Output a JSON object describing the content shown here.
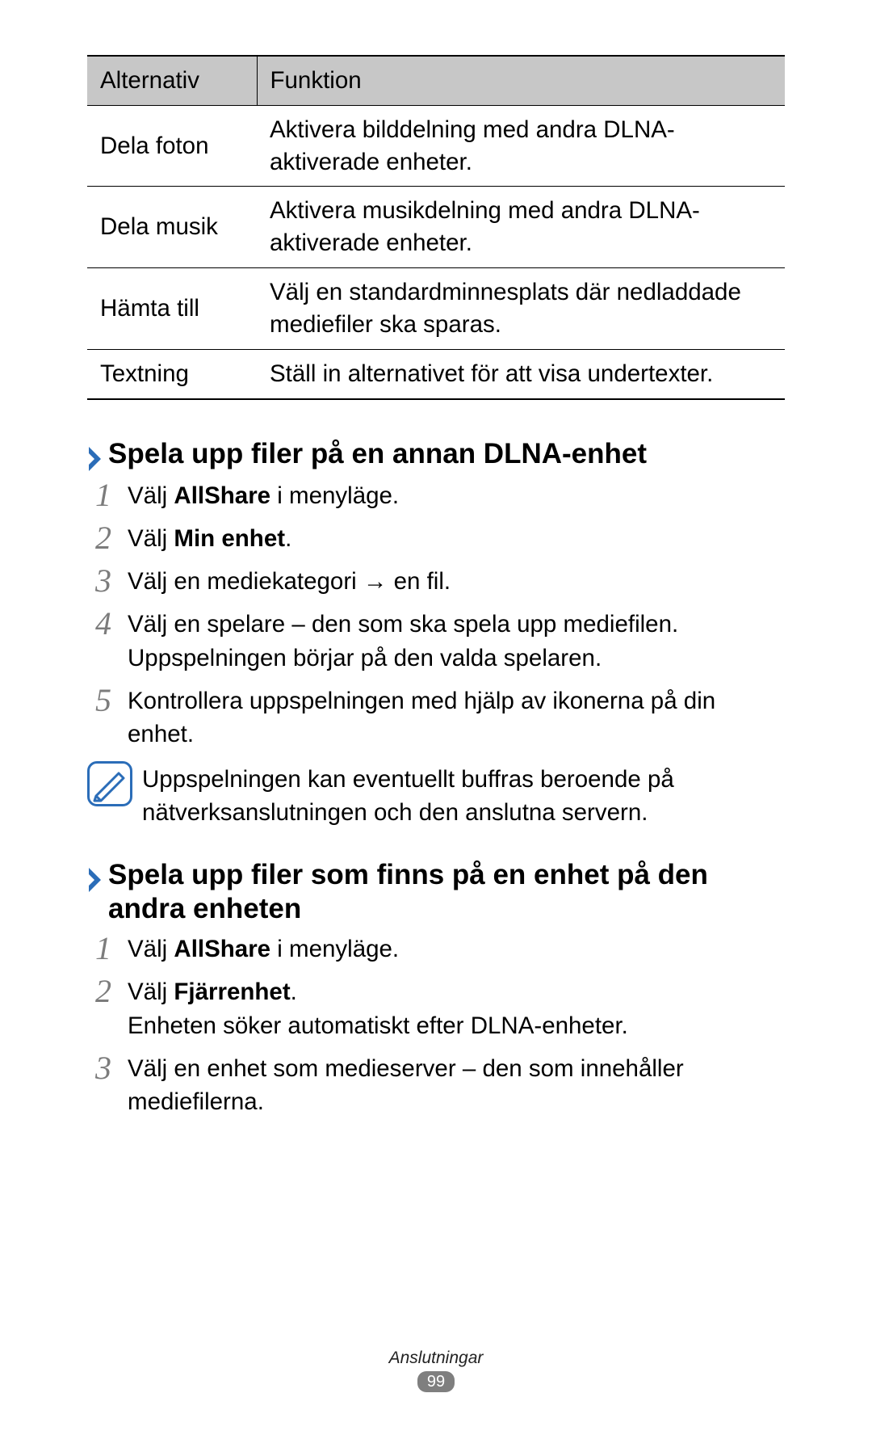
{
  "table": {
    "header": {
      "c1": "Alternativ",
      "c2": "Funktion"
    },
    "rows": [
      {
        "c1": "Dela foton",
        "c2": "Aktivera bilddelning med andra DLNA-aktiverade enheter."
      },
      {
        "c1": "Dela musik",
        "c2": "Aktivera musikdelning med andra DLNA-aktiverade enheter."
      },
      {
        "c1": "Hämta till",
        "c2": "Välj en standardminnesplats där nedladdade mediefiler ska sparas."
      },
      {
        "c1": "Textning",
        "c2": "Ställ in alternativet för att visa undertexter."
      }
    ]
  },
  "heading1": "Spela upp filer på en annan DLNA-enhet",
  "steps1": {
    "s1_a": "Välj ",
    "s1_b": "AllShare",
    "s1_c": " i menyläge.",
    "s2_a": "Välj ",
    "s2_b": "Min enhet",
    "s2_c": ".",
    "s3": "Välj en mediekategori → en fil.",
    "s4": "Välj en spelare – den som ska spela upp mediefilen. Uppspelningen börjar på den valda spelaren.",
    "s5": "Kontrollera uppspelningen med hjälp av ikonerna på din enhet."
  },
  "note1": "Uppspelningen kan eventuellt buffras beroende på nätverksanslutningen och den anslutna servern.",
  "heading2": "Spela upp filer som finns på en enhet på den andra enheten",
  "steps2": {
    "s1_a": "Välj ",
    "s1_b": "AllShare",
    "s1_c": " i menyläge.",
    "s2_a": "Välj ",
    "s2_b": "Fjärrenhet",
    "s2_c": ".",
    "s2_d": "Enheten söker automatiskt efter DLNA-enheter.",
    "s3": "Välj en enhet som medieserver – den som innehåller mediefilerna."
  },
  "nums": {
    "n1": "1",
    "n2": "2",
    "n3": "3",
    "n4": "4",
    "n5": "5"
  },
  "footer": {
    "section": "Anslutningar",
    "page": "99"
  }
}
